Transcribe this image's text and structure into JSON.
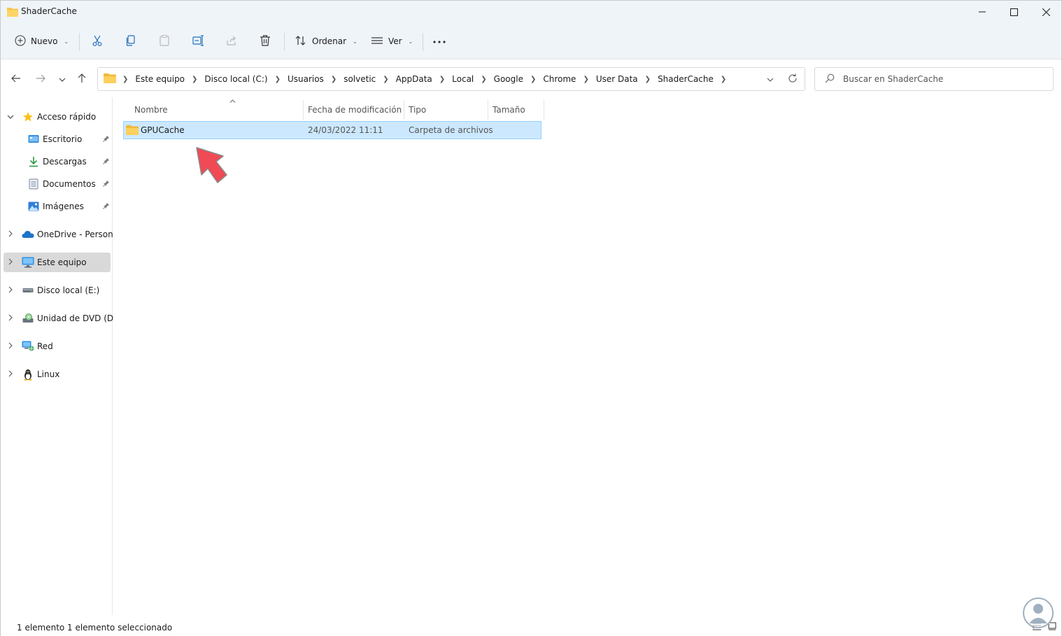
{
  "window": {
    "title": "ShaderCache"
  },
  "toolbar": {
    "new_label": "Nuevo",
    "sort_label": "Ordenar",
    "view_label": "Ver"
  },
  "address": {
    "crumbs": [
      "Este equipo",
      "Disco local (C:)",
      "Usuarios",
      "solvetic",
      "AppData",
      "Local",
      "Google",
      "Chrome",
      "User Data",
      "ShaderCache"
    ]
  },
  "search": {
    "placeholder": "Buscar en ShaderCache"
  },
  "sidebar": {
    "quick_access": "Acceso rápido",
    "items": [
      {
        "label": "Escritorio",
        "icon": "desktop-icon"
      },
      {
        "label": "Descargas",
        "icon": "download-icon"
      },
      {
        "label": "Documentos",
        "icon": "documents-icon"
      },
      {
        "label": "Imágenes",
        "icon": "pictures-icon"
      }
    ],
    "onedrive": "OneDrive - Personal",
    "this_pc": "Este equipo",
    "local_disk_e": "Disco local (E:)",
    "dvd_d": "Unidad de DVD (D:)",
    "network": "Red",
    "linux": "Linux"
  },
  "columns": {
    "name": "Nombre",
    "modified": "Fecha de modificación",
    "type": "Tipo",
    "size": "Tamaño"
  },
  "files": [
    {
      "name": "GPUCache",
      "modified": "24/03/2022 11:11",
      "type": "Carpeta de archivos",
      "size": ""
    }
  ],
  "status": {
    "count": "1 elemento",
    "selected": "1 elemento seleccionado"
  },
  "colors": {
    "accent": "#0067c0",
    "selection": "#cce8ff",
    "folder": "#f8c649",
    "annotation_arrow": "#f04a55"
  }
}
